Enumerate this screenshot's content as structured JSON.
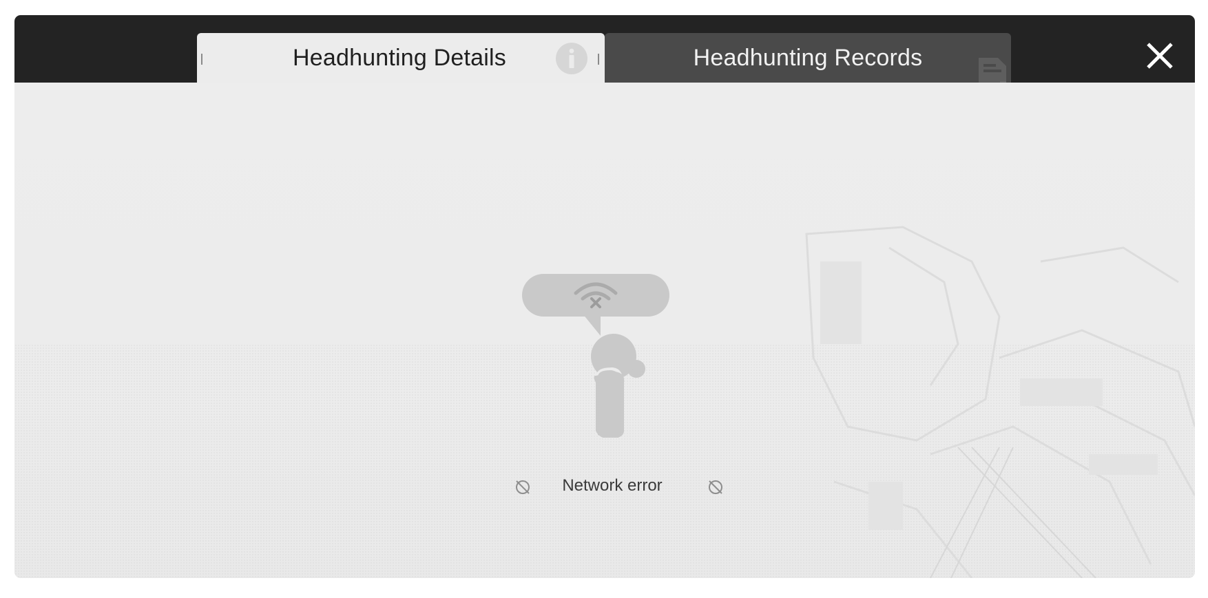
{
  "tabs": [
    {
      "label": "Headhunting Details",
      "icon": "info-icon",
      "active": true
    },
    {
      "label": "Headhunting Records",
      "icon": "records-icon",
      "active": false
    }
  ],
  "close": {
    "icon": "close-icon"
  },
  "error": {
    "message": "Network error",
    "illustration": "network-error-figure",
    "side_icons": [
      "no-signal-icon",
      "no-signal-icon"
    ]
  },
  "colors": {
    "header_bg": "#232323",
    "active_tab_bg": "#ececec",
    "inactive_tab_bg": "#4a4a4a",
    "content_bg": "#ececec",
    "illustration": "#c9c9c9",
    "text_dark": "#1f1f1f",
    "text_light": "#f2f2f2"
  }
}
